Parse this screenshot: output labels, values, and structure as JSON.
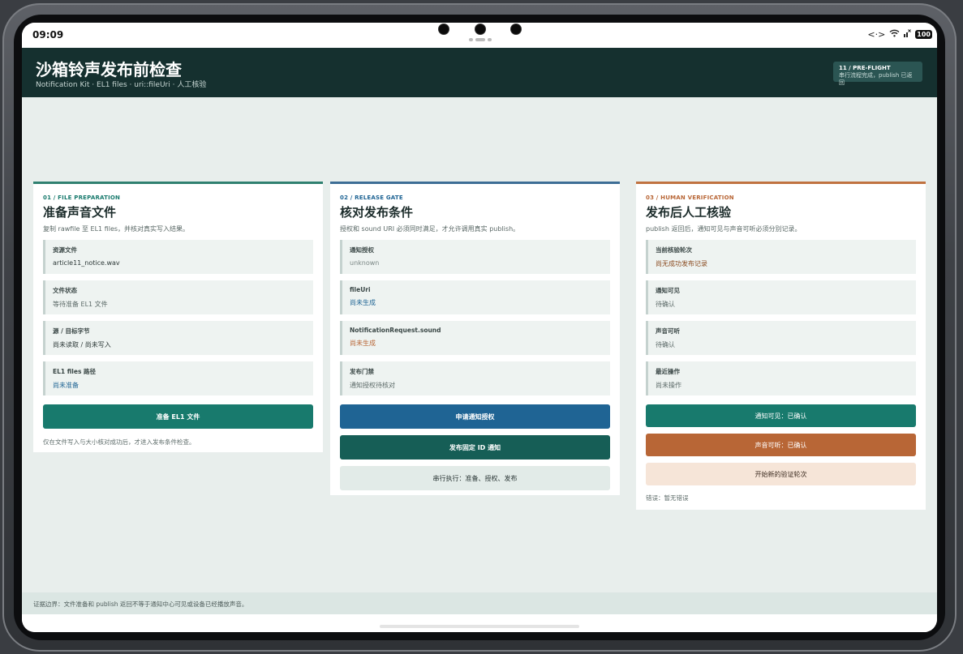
{
  "status_bar": {
    "time": "09:09",
    "battery": "100"
  },
  "header": {
    "title": "沙箱铃声发布前检查",
    "subtitle": "Notification Kit · EL1 files · uri::fileUri · 人工核验",
    "badge_title": "11 / PRE-FLIGHT",
    "badge_text": "串行流程完成，publish 已返回"
  },
  "colors": {
    "header_bg": "#15302f",
    "teal": "#187a6d",
    "blue": "#1f6494",
    "orange": "#b86636",
    "dark_teal": "#165e56"
  },
  "cards": {
    "prep": {
      "kicker": "01 / FILE PREPARATION",
      "title": "准备声音文件",
      "desc": "复制 rawfile 至 EL1 files，并核对真实写入结果。",
      "rows": [
        {
          "label": "资源文件",
          "value": "article11_notice.wav"
        },
        {
          "label": "文件状态",
          "value": "等待准备 EL1 文件"
        },
        {
          "label": "源 / 目标字节",
          "value": "尚未读取 / 尚未写入"
        },
        {
          "label": "EL1 files 路径",
          "value": "尚未准备"
        }
      ],
      "button": "准备 EL1 文件",
      "note": "仅在文件写入与大小核对成功后，才进入发布条件检查。"
    },
    "gate": {
      "kicker": "02 / RELEASE GATE",
      "title": "核对发布条件",
      "desc": "授权和 sound URI 必须同时满足，才允许调用真实 publish。",
      "rows": [
        {
          "label": "通知授权",
          "value": "unknown"
        },
        {
          "label": "fileUri",
          "value": "尚未生成"
        },
        {
          "label": "NotificationRequest.sound",
          "value": "尚未生成"
        },
        {
          "label": "发布门禁",
          "value": "通知授权待核对"
        }
      ],
      "button_auth": "申请通知授权",
      "button_publish": "发布固定 ID 通知",
      "button_serial": "串行执行：准备、授权、发布"
    },
    "verify": {
      "kicker": "03 / HUMAN VERIFICATION",
      "title": "发布后人工核验",
      "desc": "publish 返回后，通知可见与声音可听必须分别记录。",
      "rows": [
        {
          "label": "当前核验轮次",
          "value": "尚无成功发布记录"
        },
        {
          "label": "通知可见",
          "value": "待确认"
        },
        {
          "label": "声音可听",
          "value": "待确认"
        },
        {
          "label": "最近操作",
          "value": "尚未操作"
        }
      ],
      "button_visible": "通知可见：已确认",
      "button_audible": "声音可听：已确认",
      "button_new_round": "开始新的验证轮次",
      "error": "错误：暂无错误"
    }
  },
  "footer": {
    "text": "证据边界：文件准备和 publish 返回不等于通知中心可见或设备已经播放声音。"
  }
}
